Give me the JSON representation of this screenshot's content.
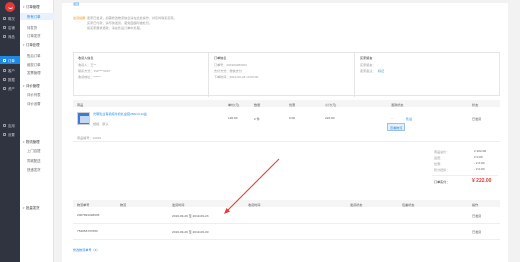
{
  "sidebar": {
    "brand_icon_label": "logo",
    "items": [
      {
        "label": "概况",
        "icon": "home-icon"
      },
      {
        "label": "店铺",
        "icon": "store-icon"
      },
      {
        "label": "商品",
        "icon": "goods-icon"
      },
      {
        "label": "订单",
        "icon": "order-icon"
      },
      {
        "label": "客户",
        "icon": "user-icon"
      },
      {
        "label": "数据",
        "icon": "chart-icon"
      },
      {
        "label": "资产",
        "icon": "wallet-icon"
      },
      {
        "label": "应用",
        "icon": "apps-icon"
      },
      {
        "label": "设置",
        "icon": "gear-icon"
      }
    ],
    "active_index": 3
  },
  "submenu": {
    "title": "订单管理",
    "items": [
      {
        "label": "订单管理",
        "type": "group"
      },
      {
        "label": "所有订单",
        "type": "leaf"
      },
      {
        "label": "待发货",
        "type": "leaf"
      },
      {
        "label": "订单发货",
        "type": "leaf"
      },
      {
        "label": "订单处理",
        "type": "group"
      },
      {
        "label": "售后订单",
        "type": "leaf"
      },
      {
        "label": "维权订单",
        "type": "leaf"
      },
      {
        "label": "发票管理",
        "type": "leaf"
      },
      {
        "label": "评价管理",
        "type": "group"
      },
      {
        "label": "评价列表",
        "type": "leaf"
      },
      {
        "label": "评价设置",
        "type": "leaf"
      },
      {
        "label": "物流管理",
        "type": "group"
      },
      {
        "label": "上门自提",
        "type": "leaf"
      },
      {
        "label": "同城配送",
        "type": "leaf"
      },
      {
        "label": "快递发货",
        "type": "leaf"
      },
      {
        "label": "批量发货",
        "type": "group"
      }
    ]
  },
  "top_link": "返回",
  "notice": {
    "title": "发货提醒：",
    "lines": [
      "卖家已发货，如需修改物流信息请在此处操作，并及时联系买家。",
      "买家已付款，请尽快发货，避免因超时被处罚。",
      "如买家要求退款，请在售后订单中处理。"
    ]
  },
  "info": {
    "buyer_title": "收货人信息",
    "buyer_lines": [
      "收货人：王**",
      "联系方式：152****0097",
      "收货地址：******"
    ],
    "order_title": "订单信息",
    "order_lines": [
      "订单号：201909280001",
      "支付方式：微信支付",
      "下单时间：2019-09-28 10:00:00"
    ],
    "remark_title": "买家留言",
    "remark_lines": [
      "买家留言：",
      "卖家备注：",
      "标记"
    ]
  },
  "goods_table": {
    "headers": [
      "商品",
      "单价(元)",
      "数量",
      "优惠",
      "小计(元)",
      "退款状态",
      "状态"
    ],
    "row": {
      "title": "光明乳业有机纯牛奶礼盒装250ml×12盒",
      "sku": "规格：默认",
      "price": "120.00",
      "qty": "2 件",
      "discount": "0.00",
      "subtotal": "222.00",
      "refund": "--",
      "status": "已发货",
      "action": "查看物流",
      "note": "售后"
    },
    "footer_code": "商品编号：10029"
  },
  "summary": {
    "rows": [
      {
        "label": "商品总价：",
        "value": "¥ 222.00"
      },
      {
        "label": "运费：",
        "value": "¥ 0.00"
      },
      {
        "label": "优惠：",
        "value": "- ¥ 0.00"
      },
      {
        "label": "积分抵扣：",
        "value": "- ¥ 0.00"
      }
    ],
    "total_label": "订单实付：",
    "total_value": "¥ 222.00"
  },
  "logistics_table": {
    "headers": [
      "物流单号",
      "物流",
      "发货时间",
      "收货时间",
      "发货状态",
      "包裹状态",
      "操作"
    ],
    "rows": [
      {
        "no": "2007891328035",
        "company": "",
        "time": "2019-09-26 至 2019-09-23",
        "status": "已发货"
      },
      {
        "no": "754053737053",
        "company": "",
        "time": "2019-09-26 至 2019-09-30",
        "status": "已发货"
      }
    ]
  },
  "bottom_link": "修改物流单号（4）"
}
